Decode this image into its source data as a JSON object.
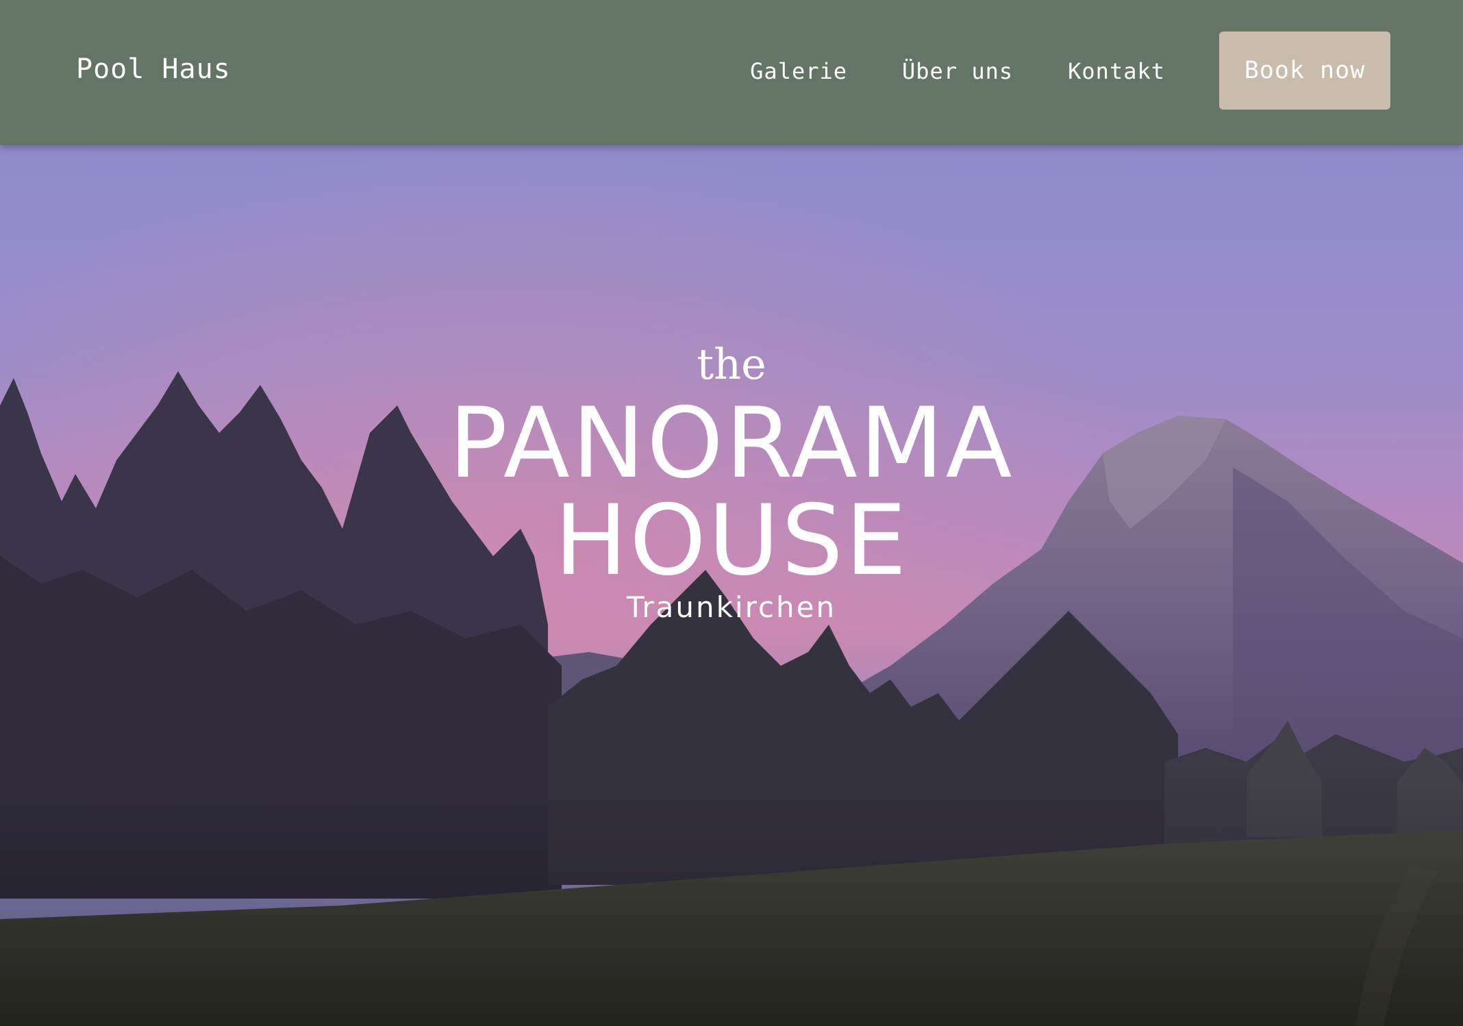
{
  "header": {
    "brand": "Pool Haus",
    "nav": [
      {
        "label": "Galerie"
      },
      {
        "label": "Über uns"
      },
      {
        "label": "Kontakt"
      }
    ],
    "cta_label": "Book now"
  },
  "hero": {
    "pre_title": "the",
    "title_line1": "PANORAMA",
    "title_line2": "HOUSE",
    "subtitle": "Traunkirchen"
  },
  "colors": {
    "header_bg": "#647565",
    "cta_bg": "#c9bcad",
    "text": "#ffffff"
  }
}
